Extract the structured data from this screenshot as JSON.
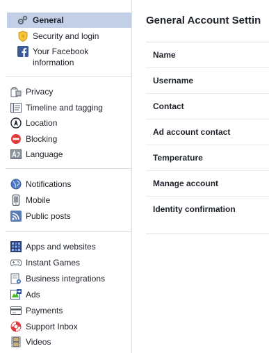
{
  "sidebar": {
    "groups": [
      {
        "items": [
          {
            "label": "General",
            "icon": "gears-icon",
            "selected": true
          },
          {
            "label": "Security and login",
            "icon": "badge-icon"
          },
          {
            "label": "Your Facebook information",
            "icon": "facebook-icon"
          }
        ]
      },
      {
        "items": [
          {
            "label": "Privacy",
            "icon": "privacy-lock-icon"
          },
          {
            "label": "Timeline and tagging",
            "icon": "timeline-icon"
          },
          {
            "label": "Location",
            "icon": "location-compass-icon"
          },
          {
            "label": "Blocking",
            "icon": "blocking-icon"
          },
          {
            "label": "Language",
            "icon": "language-icon"
          }
        ]
      },
      {
        "items": [
          {
            "label": "Notifications",
            "icon": "globe-icon"
          },
          {
            "label": "Mobile",
            "icon": "mobile-icon"
          },
          {
            "label": "Public posts",
            "icon": "rss-icon"
          }
        ]
      },
      {
        "items": [
          {
            "label": "Apps and websites",
            "icon": "apps-icon"
          },
          {
            "label": "Instant Games",
            "icon": "gamepad-icon"
          },
          {
            "label": "Business integrations",
            "icon": "business-icon"
          },
          {
            "label": "Ads",
            "icon": "ads-icon"
          },
          {
            "label": "Payments",
            "icon": "payments-card-icon"
          },
          {
            "label": "Support Inbox",
            "icon": "lifebuoy-icon"
          },
          {
            "label": "Videos",
            "icon": "film-icon"
          }
        ]
      }
    ]
  },
  "main": {
    "title": "General Account Settin",
    "rows": [
      {
        "label": "Name"
      },
      {
        "label": "Username"
      },
      {
        "label": "Contact"
      },
      {
        "label": "Ad account contact"
      },
      {
        "label": "Temperature"
      },
      {
        "label": "Manage account"
      },
      {
        "label": "Identity confirmation"
      }
    ]
  },
  "colors": {
    "selected_bg": "#c3cfe6",
    "divider": "#dddfe2",
    "text": "#1d2129",
    "facebook_blue": "#3b5998"
  }
}
